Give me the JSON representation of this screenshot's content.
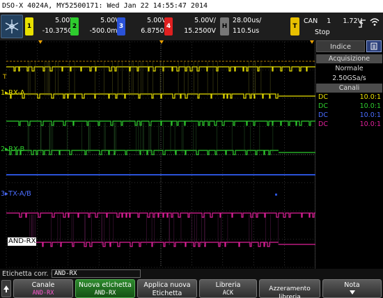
{
  "title_bar": "DSO-X 4024A, MY52500171: Wed Jan 22 14:55:47 2014",
  "colors": {
    "ch1": "#e8e000",
    "ch2": "#2ecc2e",
    "ch3": "#2a52d8",
    "ch4": "#e02020",
    "math": "#e0209a",
    "panel_header": "#4c4c4c"
  },
  "channels": [
    {
      "num": "1",
      "scale": "5.00V/",
      "offset": "-10.3750V"
    },
    {
      "num": "2",
      "scale": "5.00V/",
      "offset": "-500.0mV"
    },
    {
      "num": "3",
      "scale": "5.00V/",
      "offset": "6.8750V"
    },
    {
      "num": "4",
      "scale": "5.00V/",
      "offset": "15.2500V"
    }
  ],
  "horizontal": {
    "key": "H",
    "timebase": "28.00us/",
    "delay": "110.5us"
  },
  "trigger": {
    "key": "T",
    "source": "CAN",
    "level_ch": "1",
    "level": "1.72V",
    "status": "Stop"
  },
  "trace_labels": {
    "rx_a": "RX-A",
    "rx_b": "RX-B",
    "tx_ab": "TX-A/B",
    "and_rx": "AND-RX",
    "marker1": "1",
    "marker2": "2",
    "marker3": "3",
    "marker_t": "T"
  },
  "panel": {
    "tab_label": "Indice",
    "acq_header": "Acquisizione",
    "acq_mode": "Normale",
    "sample_rate": "2.50GSa/s",
    "channels_header": "Canali",
    "channel_rows": [
      {
        "coupling": "DC",
        "probe": "10.0:1"
      },
      {
        "coupling": "DC",
        "probe": "10.0:1"
      },
      {
        "coupling": "DC",
        "probe": "10.0:1"
      },
      {
        "coupling": "DC",
        "probe": "10.0:1"
      }
    ]
  },
  "bottom": {
    "current_label_caption": "Etichetta corr. =",
    "current_label_value": "AND-RX",
    "softkeys": [
      {
        "line1": "Canale",
        "line2": "AND-RX"
      },
      {
        "line1": "Nuova etichetta",
        "line2": "AND-RX"
      },
      {
        "line1": "Applica nuova",
        "line2": "Etichetta"
      },
      {
        "line1": "Libreria",
        "line2": "ACK"
      },
      {
        "line1": "Azzeramento libreria",
        "line2": ""
      },
      {
        "line1": "Nota",
        "line2": ""
      }
    ]
  },
  "icons": {
    "logo": "snowflake-logo-icon",
    "back": "back-arrow-icon",
    "trigger_edge": "rising-edge-icon",
    "remote": "wifi-icon",
    "menu": "menu-icon",
    "down": "chevron-down-icon"
  }
}
